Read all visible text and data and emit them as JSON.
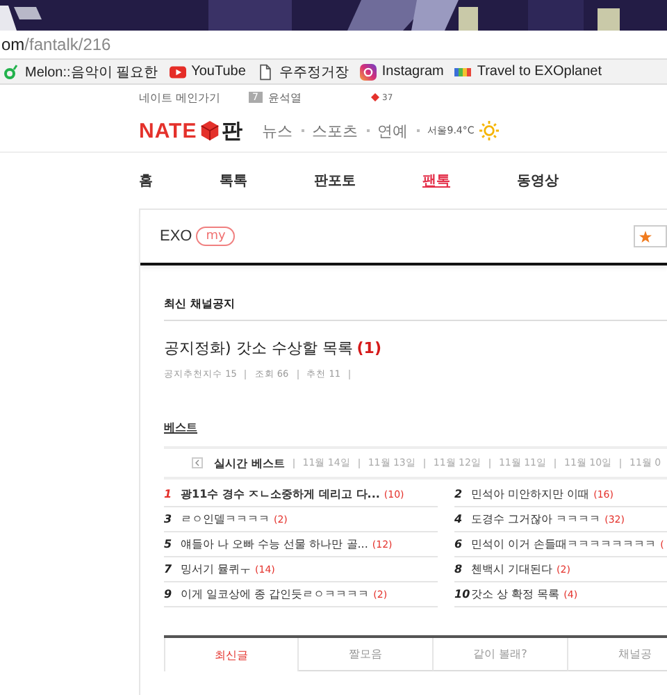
{
  "browser": {
    "url_host": "om",
    "url_path": "/fantalk/216",
    "bookmarks": [
      {
        "kind": "melon",
        "label": "Melon::음악이 필요한"
      },
      {
        "kind": "youtube",
        "label": "YouTube"
      },
      {
        "kind": "page",
        "label": "우주정거장"
      },
      {
        "kind": "instagram",
        "label": "Instagram"
      },
      {
        "kind": "flag",
        "label": "Travel to EXOplanet"
      }
    ]
  },
  "topbar": {
    "main_link": "네이트 메인가기",
    "rank_number": "7",
    "rank_keyword": "윤석열",
    "rank_change": "37"
  },
  "header": {
    "logo_text": "NATE",
    "logo_suffix": "판",
    "nav": [
      "뉴스",
      "스포츠",
      "연예"
    ],
    "weather": "서울9.4°C"
  },
  "menu": [
    {
      "label": "홈",
      "selected": false
    },
    {
      "label": "톡톡",
      "selected": false
    },
    {
      "label": "판포토",
      "selected": false
    },
    {
      "label": "팬톡",
      "selected": true
    },
    {
      "label": "동영상",
      "selected": false
    }
  ],
  "channel": {
    "name": "EXO",
    "badge": "my"
  },
  "notice": {
    "heading": "최신 채널공지",
    "title": "공지정화) 갓소 수상할 목록",
    "count": "(1)",
    "meta": [
      "공지추천지수 15",
      "조회 66",
      "추천 11"
    ]
  },
  "best": {
    "heading": "베스트",
    "tabs": [
      {
        "label": "실시간 베스트",
        "selected": true
      },
      {
        "label": "11월 14일",
        "selected": false
      },
      {
        "label": "11월 13일",
        "selected": false
      },
      {
        "label": "11월 12일",
        "selected": false
      },
      {
        "label": "11월 11일",
        "selected": false
      },
      {
        "label": "11월 10일",
        "selected": false
      },
      {
        "label": "11월 0",
        "selected": false
      }
    ],
    "items": [
      {
        "rank": "1",
        "title": "광11수 경수 ㅈㄴ소중하게 데리고 다...",
        "count": "(10)",
        "top": true
      },
      {
        "rank": "2",
        "title": "민석아 미안하지만 이때",
        "count": "(16)",
        "top": false
      },
      {
        "rank": "3",
        "title": "ㄹㅇ인델ㅋㅋㅋㅋ",
        "count": "(2)",
        "top": false
      },
      {
        "rank": "4",
        "title": "도경수 그거잖아 ㅋㅋㅋㅋ",
        "count": "(32)",
        "top": false
      },
      {
        "rank": "5",
        "title": "얘들아 나 오빠 수능 선물 하나만 골...",
        "count": "(12)",
        "top": false
      },
      {
        "rank": "6",
        "title": "민석이 이거 손들때ㅋㅋㅋㅋㅋㅋㅋㅋ",
        "count": "(",
        "top": false
      },
      {
        "rank": "7",
        "title": "밍서기 뮬퀴ㅜ",
        "count": "(14)",
        "top": false
      },
      {
        "rank": "8",
        "title": "첸백시 기대된다",
        "count": "(2)",
        "top": false
      },
      {
        "rank": "9",
        "title": "이게 일코상에 종 갑인듯ㄹㅇㅋㅋㅋㅋ",
        "count": "(2)",
        "top": false
      },
      {
        "rank": "10",
        "title": "갓소 상 확정 목록",
        "count": "(4)",
        "top": false
      }
    ]
  },
  "board_tabs": [
    {
      "label": "최신글",
      "selected": true
    },
    {
      "label": "짤모음",
      "selected": false
    },
    {
      "label": "같이 볼래?",
      "selected": false
    },
    {
      "label": "채널공",
      "selected": false
    }
  ]
}
